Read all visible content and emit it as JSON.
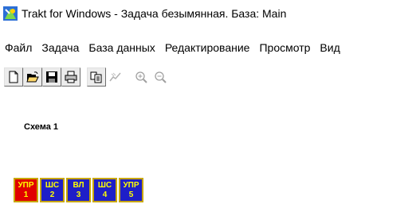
{
  "window": {
    "title": "Trakt for Windows - Задача безымянная. База: Main",
    "icon": "app-icon"
  },
  "menu": [
    {
      "label": "Файл"
    },
    {
      "label": "Задача"
    },
    {
      "label": "База данных"
    },
    {
      "label": "Редактирование"
    },
    {
      "label": "Просмотр"
    },
    {
      "label": "Вид"
    }
  ],
  "toolbar": {
    "buttons": [
      "new-icon",
      "open-icon",
      "save-icon",
      "print-icon",
      "copy-icon",
      "chart-icon",
      "zoom-in-icon",
      "zoom-out-icon"
    ]
  },
  "canvas": {
    "scheme_label": "Схема 1",
    "blocks": [
      {
        "type": "УПР",
        "num": "1",
        "color": "#e00000"
      },
      {
        "type": "ШС",
        "num": "2",
        "color": "#1e1ec8"
      },
      {
        "type": "ВЛ",
        "num": "3",
        "color": "#1e1ec8"
      },
      {
        "type": "ШС",
        "num": "4",
        "color": "#1e1ec8"
      },
      {
        "type": "УПР",
        "num": "5",
        "color": "#1e1ec8"
      }
    ]
  }
}
